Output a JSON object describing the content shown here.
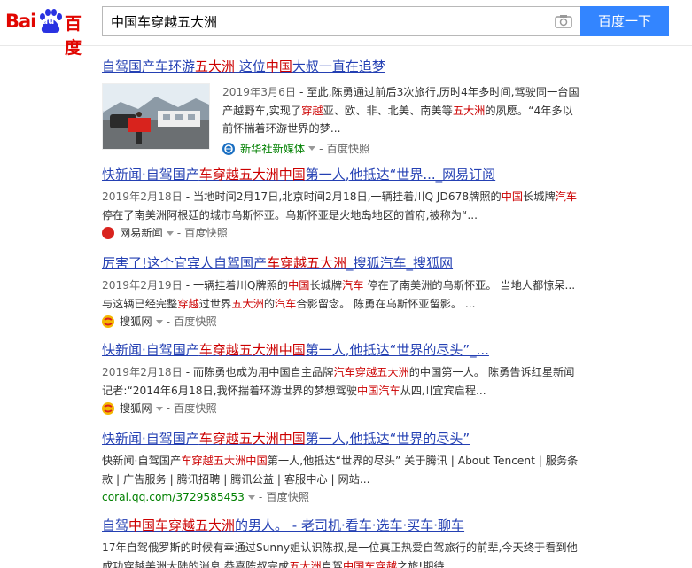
{
  "search": {
    "query": "中国车穿越五大洲",
    "button_label": "百度一下"
  },
  "logo": {
    "bai": "Bai",
    "du": "du",
    "cn": "百度"
  },
  "results": [
    {
      "title_parts": [
        [
          "n",
          "自驾国产车环游"
        ],
        [
          "e",
          "五大洲"
        ],
        [
          "n",
          " 这位"
        ],
        [
          "e",
          "中国"
        ],
        [
          "n",
          "大叔一直在追梦"
        ]
      ],
      "date": "2019年3月6日",
      "abs_parts": [
        [
          "n",
          " - 至此,陈勇通过前后3次旅行,历时4年多时间,驾驶同一台国产越野车,实现了"
        ],
        [
          "e",
          "穿越"
        ],
        [
          "n",
          "亚、欧、非、北美、南美等"
        ],
        [
          "e",
          "五大洲"
        ],
        [
          "n",
          "的夙愿。“4年多以前怀揣着环游世界的梦..."
        ]
      ],
      "source": "新华社新媒体",
      "cache": "百度快照"
    },
    {
      "title_parts": [
        [
          "n",
          "快新闻·自驾国产"
        ],
        [
          "e",
          "车穿越五大洲中国"
        ],
        [
          "n",
          "第一人,他抵达“世界..._网易订阅"
        ]
      ],
      "date": "2019年2月18日",
      "abs_parts": [
        [
          "n",
          " - 当地时间2月17日,北京时间2月18日,一辆挂着川Q JD678牌照的"
        ],
        [
          "e",
          "中国"
        ],
        [
          "n",
          "长城牌"
        ],
        [
          "e",
          "汽车"
        ],
        [
          "n",
          "停在了南美洲阿根廷的城市乌斯怀亚。乌斯怀亚是火地岛地区的首府,被称为“..."
        ]
      ],
      "source": "网易新闻",
      "cache": "百度快照"
    },
    {
      "title_parts": [
        [
          "n",
          "厉害了!这个宜宾人自驾国产"
        ],
        [
          "e",
          "车穿越五大洲"
        ],
        [
          "n",
          "_搜狐汽车_搜狐网"
        ]
      ],
      "date": "2019年2月19日",
      "abs_parts": [
        [
          "n",
          " - 一辆挂着川Q牌照的"
        ],
        [
          "e",
          "中国"
        ],
        [
          "n",
          "长城牌"
        ],
        [
          "e",
          "汽车"
        ],
        [
          "n",
          " 停在了南美洲的乌斯怀亚。 当地人都惊呆...与这辆已经完整"
        ],
        [
          "e",
          "穿越"
        ],
        [
          "n",
          "过世界"
        ],
        [
          "e",
          "五大洲"
        ],
        [
          "n",
          "的"
        ],
        [
          "e",
          "汽车"
        ],
        [
          "n",
          "合影留念。 陈勇在乌斯怀亚留影。 ..."
        ]
      ],
      "source": "搜狐网",
      "cache": "百度快照"
    },
    {
      "title_parts": [
        [
          "n",
          "快新闻·自驾国产"
        ],
        [
          "e",
          "车穿越五大洲中国"
        ],
        [
          "n",
          "第一人,他抵达“世界的尽头”_..."
        ]
      ],
      "date": "2019年2月18日",
      "abs_parts": [
        [
          "n",
          " - 而陈勇也成为用中国自主品牌"
        ],
        [
          "e",
          "汽车穿越五大洲"
        ],
        [
          "n",
          "的中国第一人。 陈勇告诉红星新闻记者:“2014年6月18日,我怀揣着环游世界的梦想驾驶"
        ],
        [
          "e",
          "中国汽车"
        ],
        [
          "n",
          "从四川宜宾启程..."
        ]
      ],
      "source": "搜狐网",
      "cache": "百度快照"
    },
    {
      "title_parts": [
        [
          "n",
          "快新闻·自驾国产"
        ],
        [
          "e",
          "车穿越五大洲中国"
        ],
        [
          "n",
          "第一人,他抵达“世界的尽头”"
        ]
      ],
      "date": "",
      "abs_parts": [
        [
          "n",
          "快新闻·自驾国产"
        ],
        [
          "e",
          "车穿越五大洲中国"
        ],
        [
          "n",
          "第一人,他抵达“世界的尽头” 关于腾讯 | About Tencent | 服务条款 | 广告服务 | 腾讯招聘 | 腾讯公益 | 客服中心 | 网站..."
        ]
      ],
      "url": "coral.qq.com/3729585453",
      "cache": "百度快照"
    },
    {
      "title_parts": [
        [
          "n",
          "自驾"
        ],
        [
          "e",
          "中国车穿越五大洲"
        ],
        [
          "n",
          "的男人。 - 老司机·看车·选车·买车·聊车"
        ]
      ],
      "date": "",
      "abs_parts": [
        [
          "n",
          "17年自驾俄罗斯的时候有幸通过Sunny姐认识陈叔,是一位真正热爱自驾旅行的前辈,今天终于看到他成功穿越美洲大陆的消息,恭喜陈叔完成"
        ],
        [
          "e",
          "五大洲"
        ],
        [
          "n",
          "自驾"
        ],
        [
          "e",
          "中国车穿越"
        ],
        [
          "n",
          "之旅!期待..."
        ]
      ]
    }
  ],
  "colors": {
    "link": "#2440b3",
    "highlight": "#cc0000",
    "button": "#3385ff",
    "logo_red": "#e10601",
    "url_green": "#008000"
  }
}
